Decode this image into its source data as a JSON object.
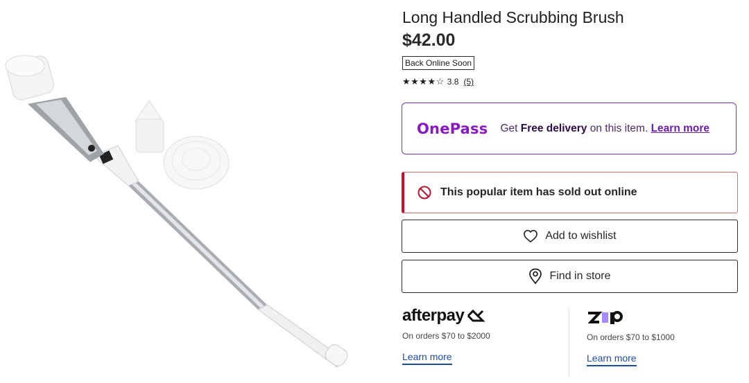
{
  "product": {
    "title": "Long Handled Scrubbing Brush",
    "price": "$42.00",
    "stock_badge": "Back Online Soon",
    "rating_stars": "★★★★☆",
    "rating_value": "3.8",
    "rating_count": "(5)"
  },
  "onepass": {
    "logo": "OnePass",
    "text_prefix": "Get ",
    "text_bold": "Free delivery",
    "text_suffix": " on this item.",
    "link": "Learn more"
  },
  "soldout": {
    "message": "This popular item has sold out online"
  },
  "actions": {
    "wishlist_label": "Add to wishlist",
    "find_store_label": "Find in store"
  },
  "payments": {
    "afterpay": {
      "logo": "afterpay",
      "note": "On orders $70 to $2000",
      "link": "Learn more"
    },
    "zip": {
      "logo": "zip",
      "note": "On orders $70 to $1000",
      "link": "Learn more"
    }
  },
  "colors": {
    "onepass_purple": "#8a17c5",
    "alert_red": "#c8102e",
    "link_blue": "#1a4bb5"
  }
}
